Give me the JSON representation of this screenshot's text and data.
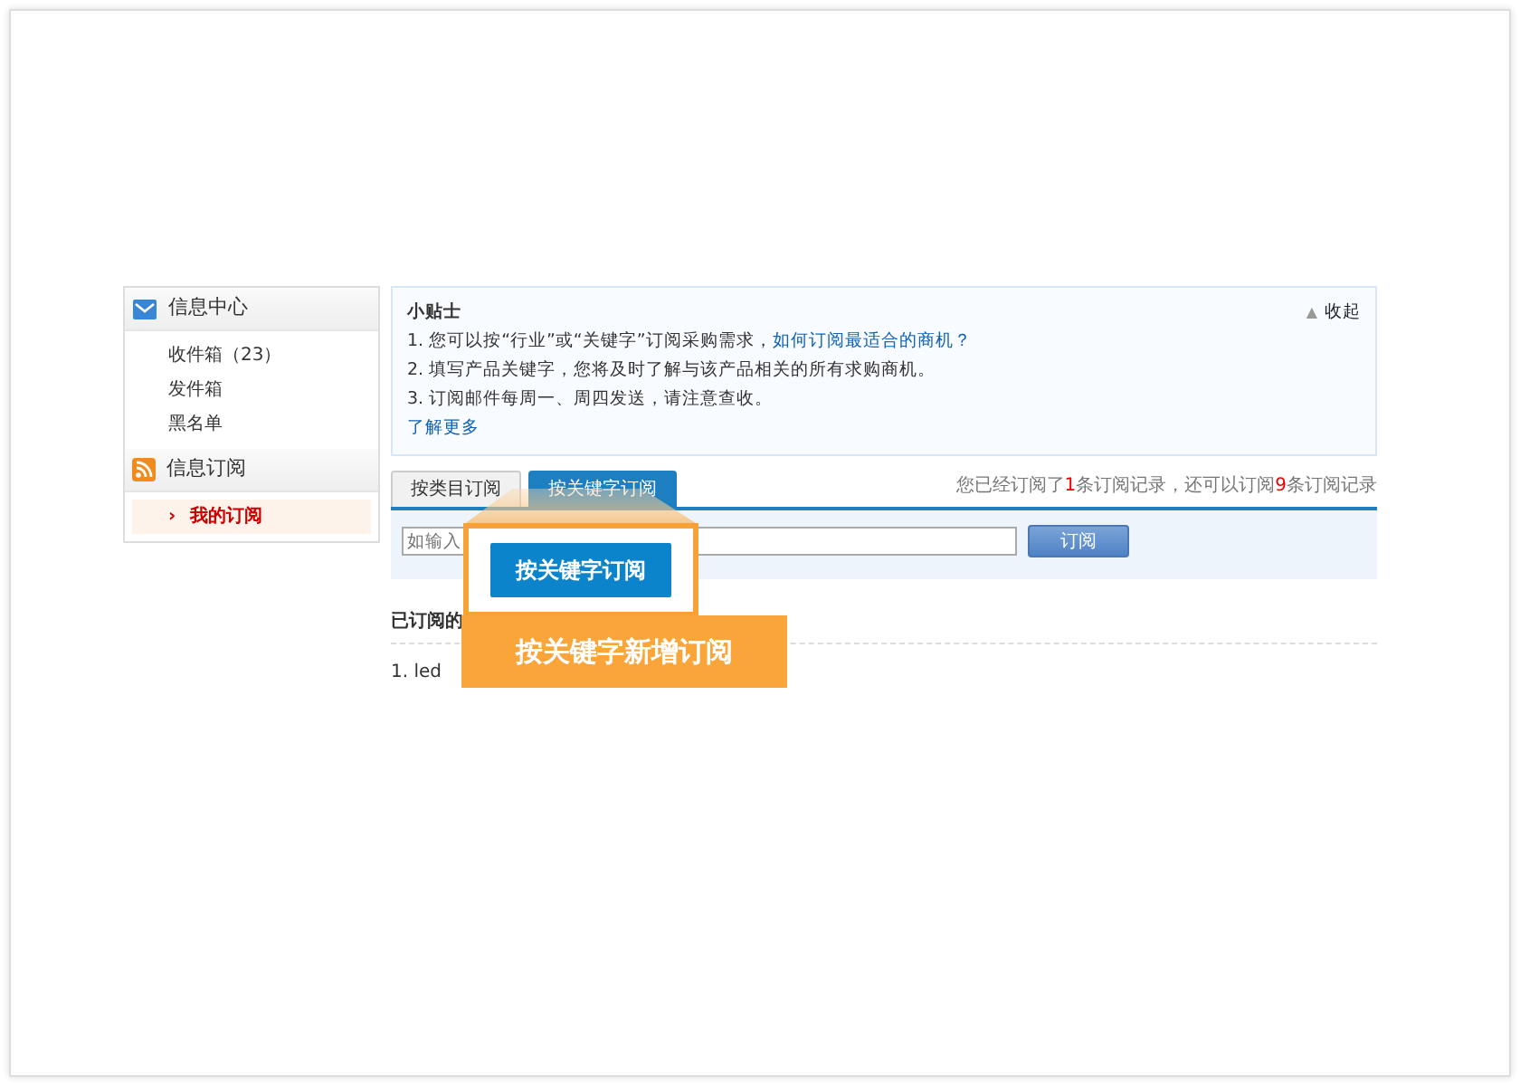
{
  "sidebar": {
    "sections": [
      {
        "title": "信息中心",
        "items": [
          {
            "label": "收件箱（23）",
            "selected": false
          },
          {
            "label": "发件箱",
            "selected": false
          },
          {
            "label": "黑名单",
            "selected": false
          }
        ]
      },
      {
        "title": "信息订阅",
        "items": [
          {
            "label": "我的订阅",
            "selected": true,
            "marker": "›"
          }
        ]
      }
    ]
  },
  "tips": {
    "title": "小贴士",
    "collapse_icon": "▲",
    "collapse": "收起",
    "lines": [
      {
        "text": "1. 您可以按“行业”或“关键字”订阅采购需求，",
        "link": "如何订阅最适合的商机？"
      },
      {
        "text": "2. 填写产品关键字，您将及时了解与该产品相关的所有求购商机。"
      },
      {
        "text": "3. 订阅邮件每周一、周四发送，请注意查收。"
      }
    ],
    "more": "了解更多"
  },
  "tabs": [
    {
      "label": "按类目订阅",
      "selected": false
    },
    {
      "label": "按关键字订阅",
      "selected": true
    }
  ],
  "summary": [
    {
      "text": "您已经订阅了",
      "highlight": false
    },
    {
      "text": "1",
      "highlight": true
    },
    {
      "text": "条订阅记录，还可以订阅",
      "highlight": false
    },
    {
      "text": "9",
      "highlight": true
    },
    {
      "text": "条订阅记录",
      "highlight": false
    }
  ],
  "form": {
    "placeholder": "如输入",
    "button": "订阅"
  },
  "subscribed": {
    "heading": "已订阅的",
    "items": [
      "1. led"
    ]
  },
  "callout": {
    "button": "按关键字订阅",
    "caption": "按关键字新增订阅"
  }
}
